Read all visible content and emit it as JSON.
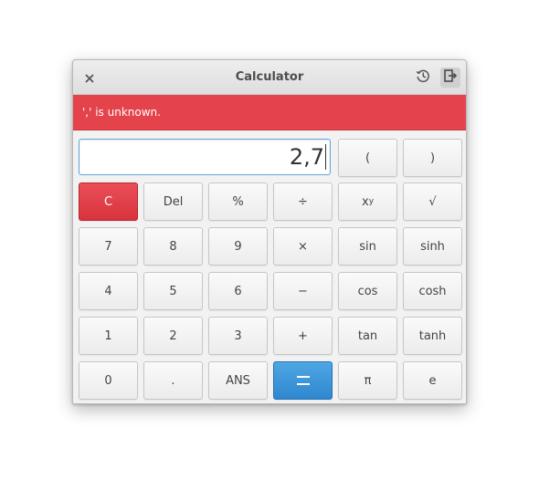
{
  "window": {
    "title": "Calculator"
  },
  "titlebar": {
    "close_icon": "close-icon",
    "history_icon": "history-icon",
    "extended_icon": "exit-panel-icon"
  },
  "infobar": {
    "message": "',' is unknown.",
    "color": "#e5434c"
  },
  "entry": {
    "value": "2,7"
  },
  "buttons": {
    "open_paren": "(",
    "close_paren": ")",
    "clear": "C",
    "delete": "Del",
    "percent": "%",
    "divide": "÷",
    "power_base": "x",
    "power_exp": "y",
    "sqrt": "√",
    "seven": "7",
    "eight": "8",
    "nine": "9",
    "multiply": "×",
    "sin": "sin",
    "sinh": "sinh",
    "four": "4",
    "five": "5",
    "six": "6",
    "minus": "−",
    "cos": "cos",
    "cosh": "cosh",
    "one": "1",
    "two": "2",
    "three": "3",
    "plus": "+",
    "tan": "tan",
    "tanh": "tanh",
    "zero": "0",
    "point": ".",
    "ans": "ANS",
    "equals": "=",
    "pi": "π",
    "e": "e"
  },
  "colors": {
    "clear_button": "#dc3a43",
    "equals_button": "#3a93d8"
  }
}
